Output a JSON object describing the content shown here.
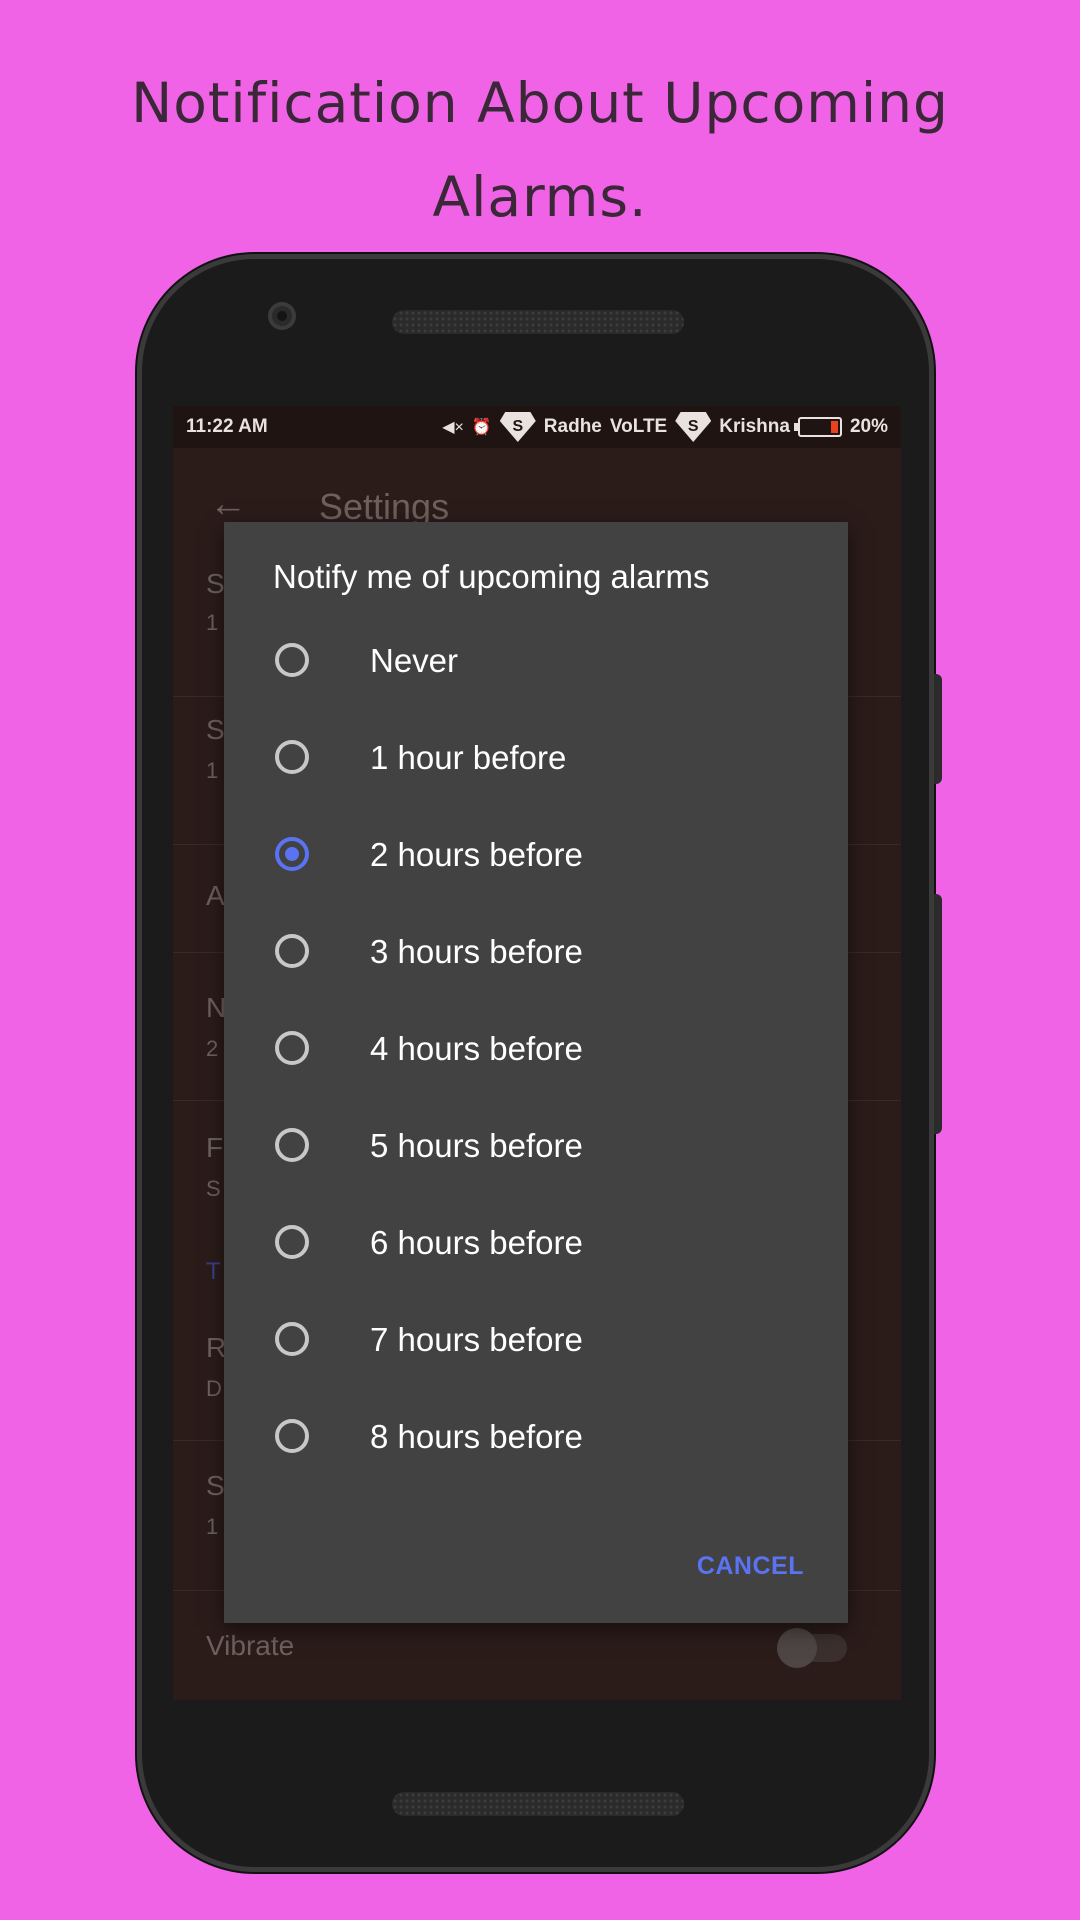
{
  "promo": {
    "title_line1": "Notification About Upcoming",
    "title_line2": "Alarms."
  },
  "status_bar": {
    "time": "11:22 AM",
    "carrier1": "Radhe",
    "network": "VoLTE",
    "carrier2": "Krishna",
    "battery": "20%",
    "icons": [
      "mute-icon",
      "alarm-icon",
      "superman-shield-icon",
      "battery-icon"
    ]
  },
  "settings": {
    "title": "Settings",
    "rows": [
      {
        "primary": "S",
        "secondary": "1"
      },
      {
        "primary": "S",
        "secondary": "1"
      },
      {
        "primary": "A",
        "secondary": ""
      },
      {
        "primary": "N",
        "secondary": "2"
      },
      {
        "primary": "F",
        "secondary": "S"
      },
      {
        "primary": "R",
        "secondary": "D"
      },
      {
        "primary": "S",
        "secondary": "1"
      }
    ],
    "section_label": "T",
    "vibrate_label": "Vibrate",
    "vibrate_on": false
  },
  "dialog": {
    "title": "Notify me of upcoming alarms",
    "options": [
      {
        "label": "Never",
        "selected": false
      },
      {
        "label": "1 hour before",
        "selected": false
      },
      {
        "label": "2 hours before",
        "selected": true
      },
      {
        "label": "3 hours before",
        "selected": false
      },
      {
        "label": "4 hours before",
        "selected": false
      },
      {
        "label": "5 hours before",
        "selected": false
      },
      {
        "label": "6 hours before",
        "selected": false
      },
      {
        "label": "7 hours before",
        "selected": false
      },
      {
        "label": "8 hours before",
        "selected": false
      }
    ],
    "cancel_label": "CANCEL"
  },
  "colors": {
    "background": "#f163e6",
    "dialog": "#424242",
    "accent": "#5a73f2",
    "screen": "#2b1c1a"
  }
}
